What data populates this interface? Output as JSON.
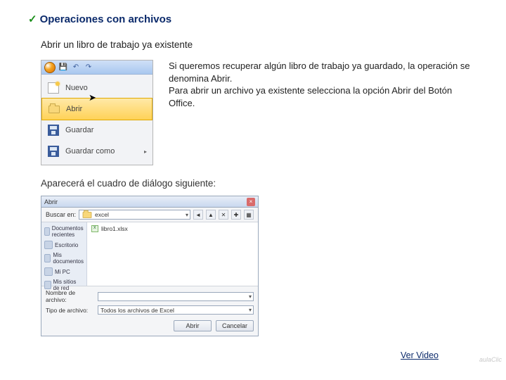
{
  "heading": "Operaciones con archivos",
  "subheading": "Abrir un libro de trabajo ya existente",
  "menu": {
    "items": [
      {
        "label": "Nuevo"
      },
      {
        "label": "Abrir"
      },
      {
        "label": "Guardar"
      },
      {
        "label": "Guardar como"
      }
    ]
  },
  "body": {
    "p1": "Si queremos recuperar algún libro de trabajo ya guardado, la operación se denomina Abrir.",
    "p2": "Para abrir un archivo ya existente selecciona la opción Abrir del Botón Office."
  },
  "sub2": "Aparecerá el cuadro de diálogo siguiente:",
  "dialog": {
    "title": "Abrir",
    "lookin_label": "Buscar en:",
    "lookin_value": "excel",
    "places": [
      "Documentos recientes",
      "Escritorio",
      "Mis documentos",
      "Mi PC",
      "Mis sitios de red"
    ],
    "file": "libro1.xlsx",
    "filename_label": "Nombre de archivo:",
    "filename_value": "",
    "filetype_label": "Tipo de archivo:",
    "filetype_value": "Todos los archivos de Excel",
    "open_btn": "Abrir",
    "cancel_btn": "Cancelar",
    "watermark": "aulaClic"
  },
  "link": "Ver Video"
}
